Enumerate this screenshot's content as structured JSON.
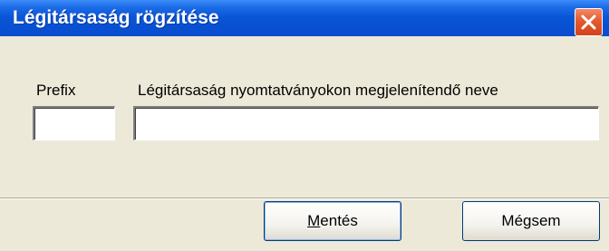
{
  "window": {
    "title": "Légitársaság rögzítése"
  },
  "form": {
    "prefix_label": "Prefix",
    "prefix_value": "",
    "name_label": "Légitársaság nyomtatványokon megjelenítendő neve",
    "name_value": ""
  },
  "buttons": {
    "save_mnemonic": "M",
    "save_rest": "entés",
    "cancel_label": "Mégsem"
  },
  "icons": {
    "close": "close-icon"
  },
  "colors": {
    "titlebar": "#0a56d8",
    "close_button": "#e35a30",
    "dialog_background": "#ece9d8"
  }
}
